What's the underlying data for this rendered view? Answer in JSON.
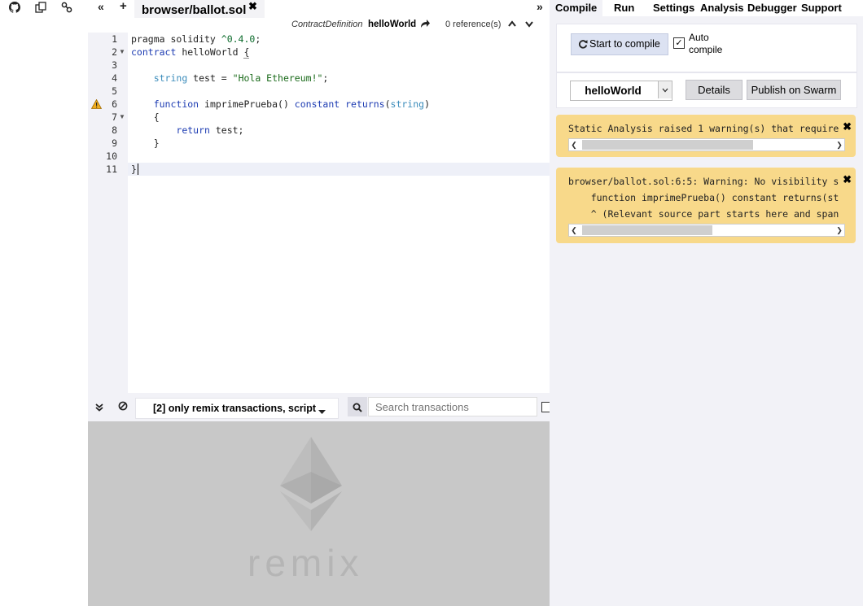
{
  "left_bar": {
    "icons": [
      "github-icon",
      "copy-icon",
      "link-icon"
    ]
  },
  "tab_strip": {
    "collapse_left": "«",
    "add_file": "+",
    "file_tab": "browser/ballot.sol",
    "close": "✖",
    "collapse_right": "»"
  },
  "context_bar": {
    "kind": "ContractDefinition",
    "name": "helloWorld",
    "references": "0 reference(s)"
  },
  "editor": {
    "line_numbers": [
      "1",
      "2",
      "3",
      "4",
      "5",
      "6",
      "7",
      "8",
      "9",
      "10",
      "11"
    ],
    "foldable_lines": [
      2,
      7
    ],
    "warning_line": 6,
    "active_line": 11,
    "lines": [
      "pragma solidity ^0.4.0;",
      "contract helloWorld {",
      "",
      "    string test = \"Hola Ethereum!\";",
      "",
      "    function imprimePrueba() constant returns(string)",
      "    {",
      "        return test;",
      "    }",
      "",
      "}"
    ]
  },
  "terminal": {
    "filter_label": "[2] only remix transactions, script",
    "search_placeholder": "Search transactions",
    "brand": "remix"
  },
  "right_panel": {
    "tabs": [
      "Compile",
      "Run",
      "Settings",
      "Analysis",
      "Debugger",
      "Support"
    ],
    "active_tab": "Compile",
    "start_compile": "Start to compile",
    "auto_compile_line1": "Auto",
    "auto_compile_line2": "compile",
    "auto_compile_checked": true,
    "contract_selected": "helloWorld",
    "details": "Details",
    "publish": "Publish on Swarm",
    "warning1": "Static Analysis raised 1 warning(s) that require",
    "warning2_line1": "browser/ballot.sol:6:5: Warning: No visibility s",
    "warning2_line2": "    function imprimePrueba() constant returns(st",
    "warning2_line3": "    ^ (Relevant source part starts here and span",
    "warning_color": "#f8d98a"
  }
}
